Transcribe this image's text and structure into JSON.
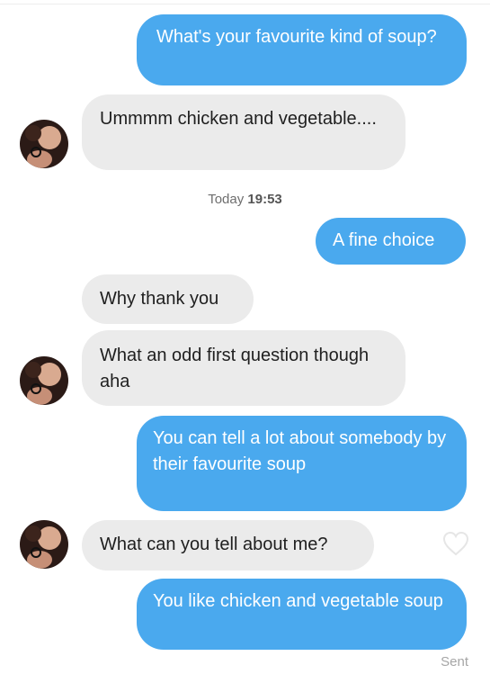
{
  "messages": [
    {
      "side": "out",
      "text": "What's your favourite kind of soup?"
    },
    {
      "side": "in",
      "text": "Ummmm chicken and vegetable...."
    },
    {
      "side": "out",
      "text": "A fine choice"
    },
    {
      "side": "in",
      "text": "Why thank you"
    },
    {
      "side": "in",
      "text": "What an odd first question though aha"
    },
    {
      "side": "out",
      "text": "You can tell a lot about somebody by their favourite soup"
    },
    {
      "side": "in",
      "text": "What can you tell about me?"
    },
    {
      "side": "out",
      "text": "You like chicken and vegetable soup"
    }
  ],
  "timestamp": {
    "day": "Today",
    "time": "19:53"
  },
  "status": "Sent",
  "colors": {
    "outgoing": "#4aa9ee",
    "incoming": "#ebebeb",
    "like_icon": "#e6e6e6"
  },
  "icons": {
    "like": "heart-icon",
    "avatar": "contact-avatar"
  }
}
